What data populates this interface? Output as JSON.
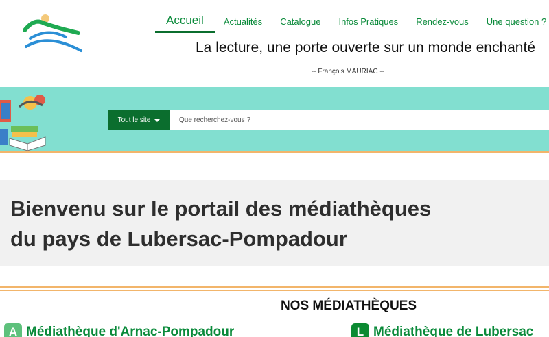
{
  "nav": {
    "items": [
      "Accueil",
      "Actualités",
      "Catalogue",
      "Infos Pratiques",
      "Rendez-vous",
      "Une question ?"
    ],
    "active": "Accueil"
  },
  "header": {
    "tagline": "La lecture, une porte ouverte sur un monde enchanté",
    "quote_author": "-- François MAURIAC --"
  },
  "search": {
    "scope_label": "Tout le site",
    "placeholder": "Que recherchez-vous ?"
  },
  "welcome": {
    "line1": "Bienvenu sur le portail des médiathèques",
    "line2": "du pays de Lubersac-Pompadour"
  },
  "mediatheques": {
    "title": "NOS MÉDIATHÈQUES",
    "items": [
      {
        "badge": "A",
        "name": "Médiathèque d'Arnac-Pompadour"
      },
      {
        "badge": "L",
        "name": "Médiathèque de Lubersac"
      }
    ]
  },
  "colors": {
    "brand_green": "#0b6e2e",
    "link_green": "#0a8a3a",
    "band_teal": "#82dfd0",
    "accent_orange": "#f2b56b"
  }
}
